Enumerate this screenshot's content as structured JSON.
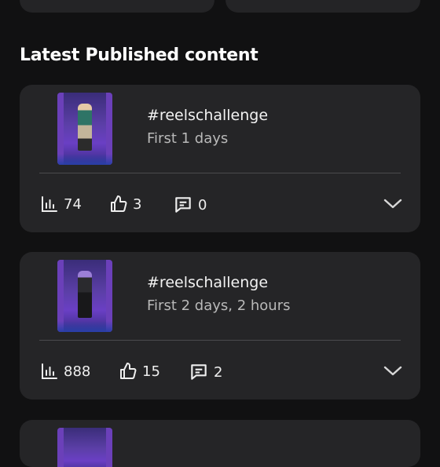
{
  "section_title": "Latest Published content",
  "posts": [
    {
      "title": "#reelschallenge",
      "age": "First 1 days",
      "views": "74",
      "likes": "3",
      "comments": "0"
    },
    {
      "title": "#reelschallenge",
      "age": "First 2 days, 2 hours",
      "views": "888",
      "likes": "15",
      "comments": "2"
    }
  ],
  "icons": {
    "views": "bar-chart-icon",
    "likes": "thumbs-up-icon",
    "comments": "comment-icon",
    "expand": "chevron-down-icon"
  },
  "colors": {
    "background": "#111112",
    "card": "#252527",
    "accent_thumb": "#6b40b9"
  }
}
